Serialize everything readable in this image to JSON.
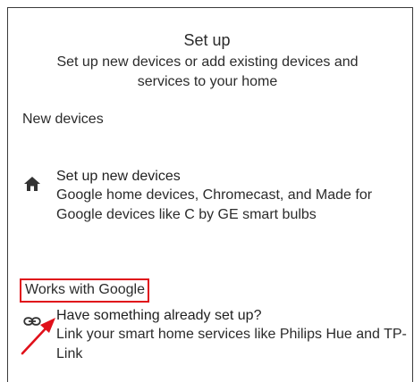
{
  "header": {
    "title": "Set up",
    "subtitle": "Set up new devices or add existing devices and services to your home"
  },
  "sections": {
    "new_devices": {
      "label": "New devices",
      "item": {
        "icon": "home-icon",
        "title": "Set up new devices",
        "description": "Google home devices, Chromecast, and Made for Google devices like C by GE smart bulbs"
      }
    },
    "works_with_google": {
      "label": "Works with Google",
      "item": {
        "icon": "link-icon",
        "title": "Have something already set up?",
        "description": "Link your smart home services like Philips Hue and TP-Link"
      }
    }
  },
  "colors": {
    "highlight": "#e0101a",
    "text": "#2b2b2b",
    "icon": "#333333"
  }
}
